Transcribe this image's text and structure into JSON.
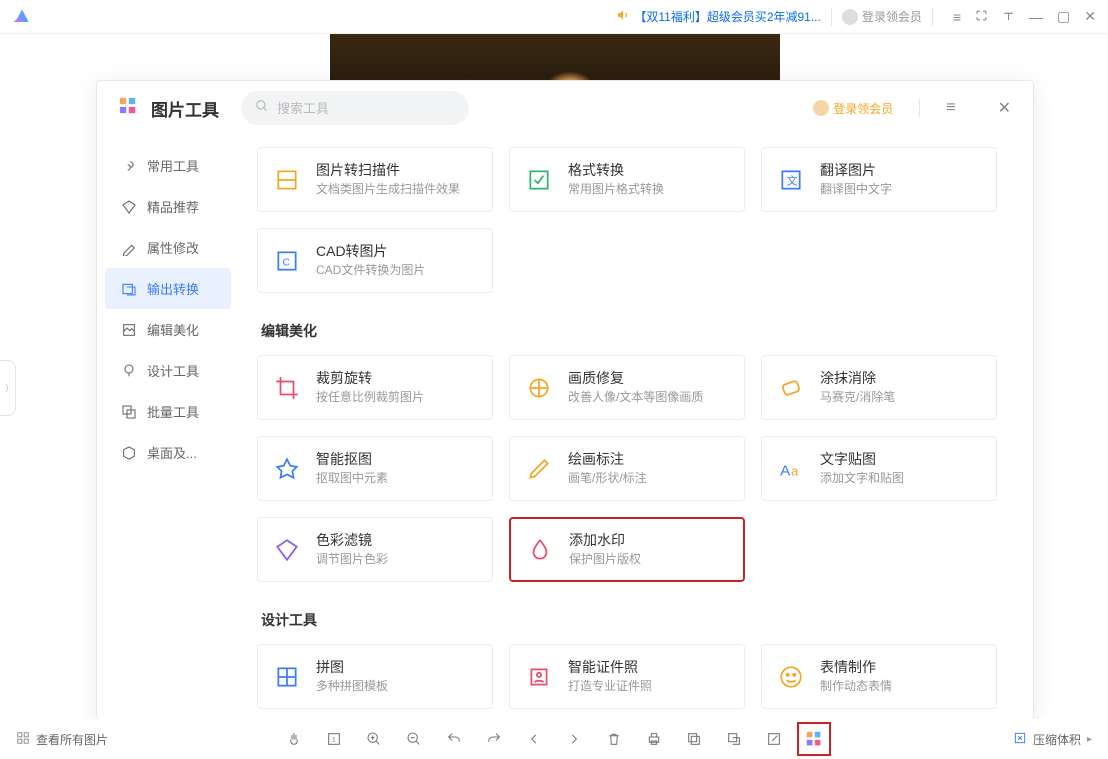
{
  "titlebar": {
    "promo": "【双11福利】超级会员买2年减91...",
    "login": "登录领会员"
  },
  "panel": {
    "title": "图片工具",
    "search_placeholder": "搜索工具",
    "login": "登录领会员"
  },
  "sidebar": {
    "items": [
      {
        "label": "常用工具"
      },
      {
        "label": "精品推荐"
      },
      {
        "label": "属性修改"
      },
      {
        "label": "输出转换"
      },
      {
        "label": "编辑美化"
      },
      {
        "label": "设计工具"
      },
      {
        "label": "批量工具"
      },
      {
        "label": "桌面及..."
      }
    ]
  },
  "sections": [
    {
      "title": "",
      "cards": [
        {
          "title": "图片转扫描件",
          "desc": "文档类图片生成扫描件效果"
        },
        {
          "title": "格式转换",
          "desc": "常用图片格式转换"
        },
        {
          "title": "翻译图片",
          "desc": "翻译图中文字"
        },
        {
          "title": "CAD转图片",
          "desc": "CAD文件转换为图片"
        }
      ]
    },
    {
      "title": "编辑美化",
      "cards": [
        {
          "title": "裁剪旋转",
          "desc": "按任意比例裁剪图片"
        },
        {
          "title": "画质修复",
          "desc": "改善人像/文本等图像画质"
        },
        {
          "title": "涂抹消除",
          "desc": "马赛克/消除笔"
        },
        {
          "title": "智能抠图",
          "desc": "抠取图中元素"
        },
        {
          "title": "绘画标注",
          "desc": "画笔/形状/标注"
        },
        {
          "title": "文字贴图",
          "desc": "添加文字和贴图"
        },
        {
          "title": "色彩滤镜",
          "desc": "调节图片色彩"
        },
        {
          "title": "添加水印",
          "desc": "保护图片版权"
        }
      ]
    },
    {
      "title": "设计工具",
      "cards": [
        {
          "title": "拼图",
          "desc": "多种拼图模板"
        },
        {
          "title": "智能证件照",
          "desc": "打造专业证件照"
        },
        {
          "title": "表情制作",
          "desc": "制作动态表情"
        }
      ]
    }
  ],
  "bottombar": {
    "view_all": "查看所有图片",
    "compress": "压缩体积"
  }
}
